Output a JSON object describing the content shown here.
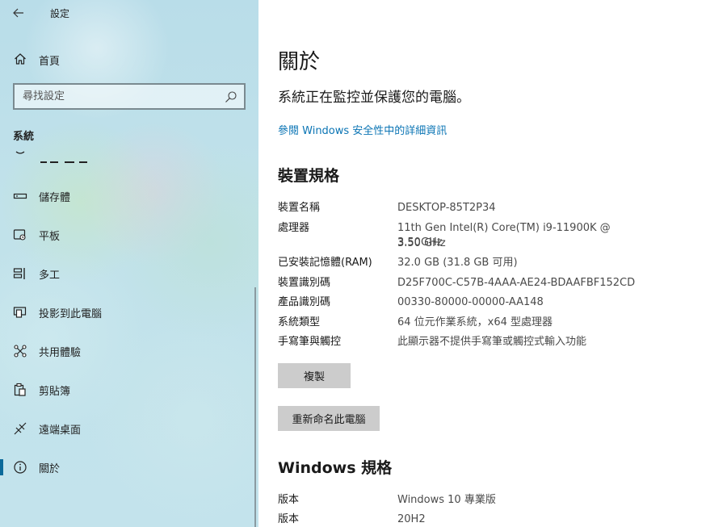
{
  "window": {
    "title": "設定"
  },
  "sidebar": {
    "home_label": "首頁",
    "search": {
      "placeholder": "尋找設定"
    },
    "section_title": "系統",
    "items": [
      {
        "label": "儲存體",
        "icon": "storage-icon"
      },
      {
        "label": "平板",
        "icon": "tablet-icon"
      },
      {
        "label": "多工",
        "icon": "multitasking-icon"
      },
      {
        "label": "投影到此電腦",
        "icon": "project-icon"
      },
      {
        "label": "共用體驗",
        "icon": "shared-experiences-icon"
      },
      {
        "label": "剪貼簿",
        "icon": "clipboard-icon"
      },
      {
        "label": "遠端桌面",
        "icon": "remote-desktop-icon"
      },
      {
        "label": "關於",
        "icon": "info-icon",
        "selected": true
      }
    ]
  },
  "main": {
    "title": "關於",
    "status": "系統正在監控並保護您的電腦。",
    "security_link": "參閱 Windows 安全性中的詳細資訊",
    "device_specs": {
      "heading": "裝置規格",
      "rows": [
        {
          "label": "裝置名稱",
          "value": "DESKTOP-85T2P34"
        },
        {
          "label": "處理器",
          "value": "11th Gen Intel(R) Core(TM) i9-11900K @ 3.50GHz",
          "value2": "3.50 GHz"
        },
        {
          "label": "已安裝記憶體(RAM)",
          "value": "32.0 GB (31.8 GB 可用)"
        },
        {
          "label": "裝置識別碼",
          "value": "D25F700C-C57B-4AAA-AE24-BDAAFBF152CD"
        },
        {
          "label": "產品識別碼",
          "value": "00330-80000-00000-AA148"
        },
        {
          "label": "系統類型",
          "value": "64 位元作業系統，x64 型處理器"
        },
        {
          "label": "手寫筆與觸控",
          "value": "此顯示器不提供手寫筆或觸控式輸入功能"
        }
      ],
      "copy_button": "複製",
      "rename_button": "重新命名此電腦"
    },
    "windows_specs": {
      "heading": "Windows 規格",
      "rows": [
        {
          "label": "版本",
          "value": "Windows 10 專業版"
        },
        {
          "label": "版本",
          "value": "20H2"
        }
      ]
    }
  },
  "colors": {
    "accent": "#0a74b4",
    "selected_bar": "#0b6a9a",
    "button_bg": "#cccccc",
    "sidebar_bg": "#c1e2ea"
  }
}
